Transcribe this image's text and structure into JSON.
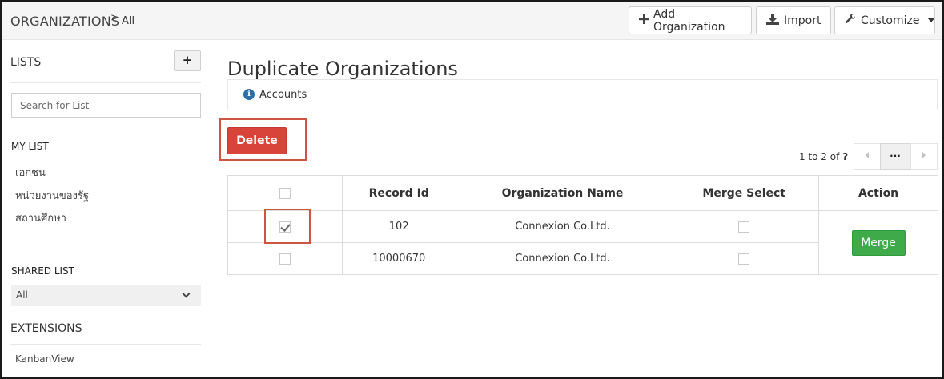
{
  "header": {
    "module": "ORGANIZATIONS",
    "separator": ">",
    "view": "All",
    "buttons": {
      "add": "Add Organization",
      "import": "Import",
      "customize": "Customize"
    }
  },
  "sidebar": {
    "lists_title": "LISTS",
    "add_label": "+",
    "search_placeholder": "Search for List",
    "my_list_title": "MY LIST",
    "my_list": [
      "เอกชน",
      "หน่วยงานของรัฐ",
      "สถานศึกษา"
    ],
    "shared_list_title": "SHARED LIST",
    "shared_selected": "All",
    "extensions_title": "EXTENSIONS",
    "extensions": [
      "KanbanView"
    ]
  },
  "main": {
    "title": "Duplicate Organizations",
    "info_label": "Accounts",
    "delete_label": "Delete",
    "pager": {
      "range": "1 to 2",
      "of_label": "of",
      "total": "?",
      "more": "···"
    },
    "table": {
      "headers": [
        "Record Id",
        "Organization Name",
        "Merge Select",
        "Action"
      ],
      "rows": [
        {
          "record_id": "102",
          "name": "Connexion Co.Ltd.",
          "checked": true
        },
        {
          "record_id": "10000670",
          "name": "Connexion Co.Ltd.",
          "checked": false
        }
      ],
      "merge_label": "Merge"
    }
  },
  "colors": {
    "delete": "#d9443a",
    "merge": "#3eaa4a",
    "highlight": "#cc5544",
    "info": "#2c6ea6"
  }
}
